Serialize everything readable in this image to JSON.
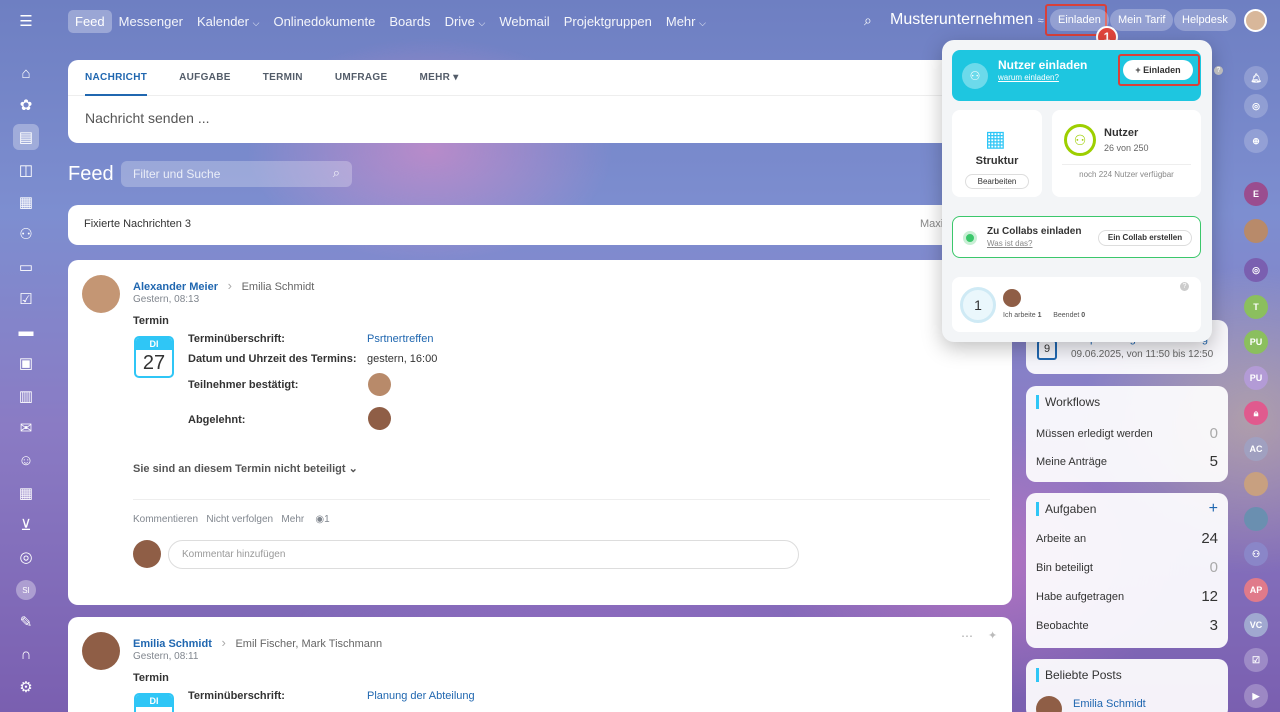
{
  "topnav": [
    "Feed",
    "Messenger",
    "Kalender",
    "Onlinedokumente",
    "Boards",
    "Drive",
    "Webmail",
    "Projektgruppen",
    "Mehr"
  ],
  "topnav_dropdowns": {
    "Kalender": "⌵",
    "Drive": "⌵",
    "Mehr": "⌵"
  },
  "company": "Musterunternehmen",
  "buttons": {
    "invite": "Einladen",
    "tarif": "Mein Tarif",
    "helpdesk": "Helpdesk"
  },
  "step_badge": "1",
  "composer": {
    "tabs": [
      "NACHRICHT",
      "AUFGABE",
      "TERMIN",
      "UMFRAGE",
      "MEHR"
    ],
    "placeholder": "Nachricht senden ..."
  },
  "feed": {
    "title": "Feed",
    "filter_placeholder": "Filter und Suche"
  },
  "pinned": {
    "label": "Fixierte Nachrichten",
    "count": "3",
    "right": "Maxi"
  },
  "post1": {
    "author": "Alexander Meier",
    "recipient": "Emilia Schmidt",
    "time": "Gestern, 08:13",
    "type": "Termin",
    "cal_day": "DI",
    "cal_num": "27",
    "fields": [
      {
        "label": "Terminüberschrift:",
        "value": "Psrtnertreffen"
      },
      {
        "label": "Datum und Uhrzeit des Termins:",
        "value": "gestern, 16:00"
      },
      {
        "label": "Teilnehmer bestätigt:",
        "value": ""
      },
      {
        "label": "Abgelehnt:",
        "value": ""
      }
    ],
    "not_participating": "Sie sind an diesem Termin nicht beteiligt",
    "actions": [
      "Kommentieren",
      "Nicht verfolgen",
      "Mehr"
    ],
    "views": "1",
    "comment_placeholder": "Kommentar hinzufügen"
  },
  "post2": {
    "author": "Emilia Schmidt",
    "recipient": "Emil Fischer, Mark Tischmann",
    "time": "Gestern, 08:11",
    "type": "Termin",
    "cal_day": "DI",
    "fields": [
      {
        "label": "Terminüberschrift:",
        "value": "Planung der Abteilung"
      }
    ]
  },
  "popup": {
    "invite_title": "Nutzer einladen",
    "invite_sub": "warum einladen?",
    "invite_btn": "+ Einladen",
    "struktur": "Struktur",
    "struktur_btn": "Bearbeiten",
    "nutzer": "Nutzer",
    "nutzer_count": "26 von 250",
    "nutzer_avail": "noch 224 Nutzer verfügbar",
    "collab_title": "Zu Collabs einladen",
    "collab_sub": "Was ist das?",
    "collab_btn": "Ein Collab erstellen",
    "work_num": "1",
    "work_label": "Ich arbeite",
    "work_val": "1",
    "done_label": "Beendet",
    "done_val": "0"
  },
  "event_widget": {
    "day": "9",
    "title": "Besprechung des Marketing",
    "when": "09.06.2025, von 11:50 bis 12:50"
  },
  "workflows": {
    "title": "Workflows",
    "rows": [
      {
        "label": "Müssen erledigt werden",
        "value": "0"
      },
      {
        "label": "Meine Anträge",
        "value": "5"
      }
    ]
  },
  "tasks": {
    "title": "Aufgaben",
    "rows": [
      {
        "label": "Arbeite an",
        "value": "24"
      },
      {
        "label": "Bin beteiligt",
        "value": "0"
      },
      {
        "label": "Habe aufgetragen",
        "value": "12"
      },
      {
        "label": "Beobachte",
        "value": "3"
      }
    ]
  },
  "popular": {
    "title": "Beliebte Posts",
    "author": "Emilia Schmidt"
  },
  "rail_initials": {
    "si": "SI"
  },
  "right_rail": [
    "T",
    "PU",
    "PU",
    "AC",
    "AP",
    "VC"
  ],
  "colors": {
    "accent": "#2067b0",
    "cyan": "#2fc6f6",
    "green": "#9dcf00",
    "red": "#e2453c"
  }
}
